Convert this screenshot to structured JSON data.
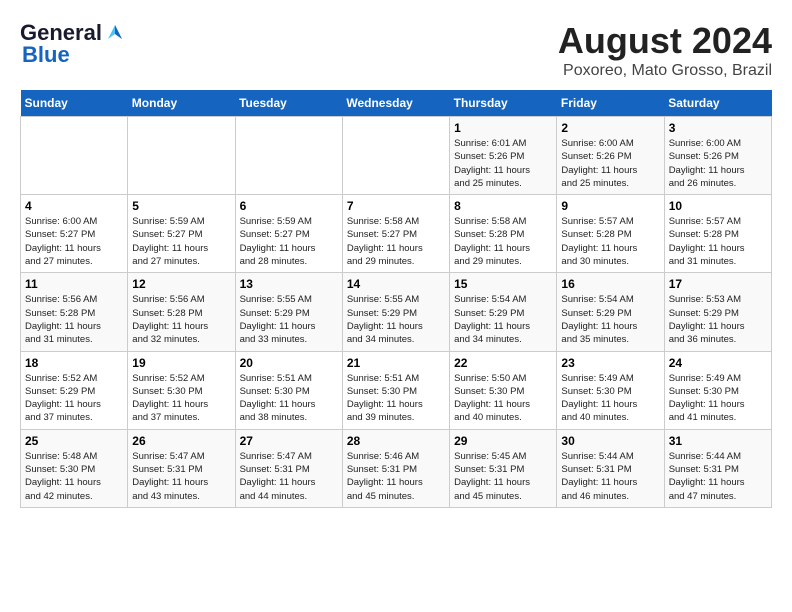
{
  "header": {
    "logo_general": "General",
    "logo_blue": "Blue",
    "month": "August 2024",
    "location": "Poxoreo, Mato Grosso, Brazil"
  },
  "days_of_week": [
    "Sunday",
    "Monday",
    "Tuesday",
    "Wednesday",
    "Thursday",
    "Friday",
    "Saturday"
  ],
  "weeks": [
    [
      {
        "day": "",
        "info": ""
      },
      {
        "day": "",
        "info": ""
      },
      {
        "day": "",
        "info": ""
      },
      {
        "day": "",
        "info": ""
      },
      {
        "day": "1",
        "info": "Sunrise: 6:01 AM\nSunset: 5:26 PM\nDaylight: 11 hours\nand 25 minutes."
      },
      {
        "day": "2",
        "info": "Sunrise: 6:00 AM\nSunset: 5:26 PM\nDaylight: 11 hours\nand 25 minutes."
      },
      {
        "day": "3",
        "info": "Sunrise: 6:00 AM\nSunset: 5:26 PM\nDaylight: 11 hours\nand 26 minutes."
      }
    ],
    [
      {
        "day": "4",
        "info": "Sunrise: 6:00 AM\nSunset: 5:27 PM\nDaylight: 11 hours\nand 27 minutes."
      },
      {
        "day": "5",
        "info": "Sunrise: 5:59 AM\nSunset: 5:27 PM\nDaylight: 11 hours\nand 27 minutes."
      },
      {
        "day": "6",
        "info": "Sunrise: 5:59 AM\nSunset: 5:27 PM\nDaylight: 11 hours\nand 28 minutes."
      },
      {
        "day": "7",
        "info": "Sunrise: 5:58 AM\nSunset: 5:27 PM\nDaylight: 11 hours\nand 29 minutes."
      },
      {
        "day": "8",
        "info": "Sunrise: 5:58 AM\nSunset: 5:28 PM\nDaylight: 11 hours\nand 29 minutes."
      },
      {
        "day": "9",
        "info": "Sunrise: 5:57 AM\nSunset: 5:28 PM\nDaylight: 11 hours\nand 30 minutes."
      },
      {
        "day": "10",
        "info": "Sunrise: 5:57 AM\nSunset: 5:28 PM\nDaylight: 11 hours\nand 31 minutes."
      }
    ],
    [
      {
        "day": "11",
        "info": "Sunrise: 5:56 AM\nSunset: 5:28 PM\nDaylight: 11 hours\nand 31 minutes."
      },
      {
        "day": "12",
        "info": "Sunrise: 5:56 AM\nSunset: 5:28 PM\nDaylight: 11 hours\nand 32 minutes."
      },
      {
        "day": "13",
        "info": "Sunrise: 5:55 AM\nSunset: 5:29 PM\nDaylight: 11 hours\nand 33 minutes."
      },
      {
        "day": "14",
        "info": "Sunrise: 5:55 AM\nSunset: 5:29 PM\nDaylight: 11 hours\nand 34 minutes."
      },
      {
        "day": "15",
        "info": "Sunrise: 5:54 AM\nSunset: 5:29 PM\nDaylight: 11 hours\nand 34 minutes."
      },
      {
        "day": "16",
        "info": "Sunrise: 5:54 AM\nSunset: 5:29 PM\nDaylight: 11 hours\nand 35 minutes."
      },
      {
        "day": "17",
        "info": "Sunrise: 5:53 AM\nSunset: 5:29 PM\nDaylight: 11 hours\nand 36 minutes."
      }
    ],
    [
      {
        "day": "18",
        "info": "Sunrise: 5:52 AM\nSunset: 5:29 PM\nDaylight: 11 hours\nand 37 minutes."
      },
      {
        "day": "19",
        "info": "Sunrise: 5:52 AM\nSunset: 5:30 PM\nDaylight: 11 hours\nand 37 minutes."
      },
      {
        "day": "20",
        "info": "Sunrise: 5:51 AM\nSunset: 5:30 PM\nDaylight: 11 hours\nand 38 minutes."
      },
      {
        "day": "21",
        "info": "Sunrise: 5:51 AM\nSunset: 5:30 PM\nDaylight: 11 hours\nand 39 minutes."
      },
      {
        "day": "22",
        "info": "Sunrise: 5:50 AM\nSunset: 5:30 PM\nDaylight: 11 hours\nand 40 minutes."
      },
      {
        "day": "23",
        "info": "Sunrise: 5:49 AM\nSunset: 5:30 PM\nDaylight: 11 hours\nand 40 minutes."
      },
      {
        "day": "24",
        "info": "Sunrise: 5:49 AM\nSunset: 5:30 PM\nDaylight: 11 hours\nand 41 minutes."
      }
    ],
    [
      {
        "day": "25",
        "info": "Sunrise: 5:48 AM\nSunset: 5:30 PM\nDaylight: 11 hours\nand 42 minutes."
      },
      {
        "day": "26",
        "info": "Sunrise: 5:47 AM\nSunset: 5:31 PM\nDaylight: 11 hours\nand 43 minutes."
      },
      {
        "day": "27",
        "info": "Sunrise: 5:47 AM\nSunset: 5:31 PM\nDaylight: 11 hours\nand 44 minutes."
      },
      {
        "day": "28",
        "info": "Sunrise: 5:46 AM\nSunset: 5:31 PM\nDaylight: 11 hours\nand 45 minutes."
      },
      {
        "day": "29",
        "info": "Sunrise: 5:45 AM\nSunset: 5:31 PM\nDaylight: 11 hours\nand 45 minutes."
      },
      {
        "day": "30",
        "info": "Sunrise: 5:44 AM\nSunset: 5:31 PM\nDaylight: 11 hours\nand 46 minutes."
      },
      {
        "day": "31",
        "info": "Sunrise: 5:44 AM\nSunset: 5:31 PM\nDaylight: 11 hours\nand 47 minutes."
      }
    ]
  ]
}
